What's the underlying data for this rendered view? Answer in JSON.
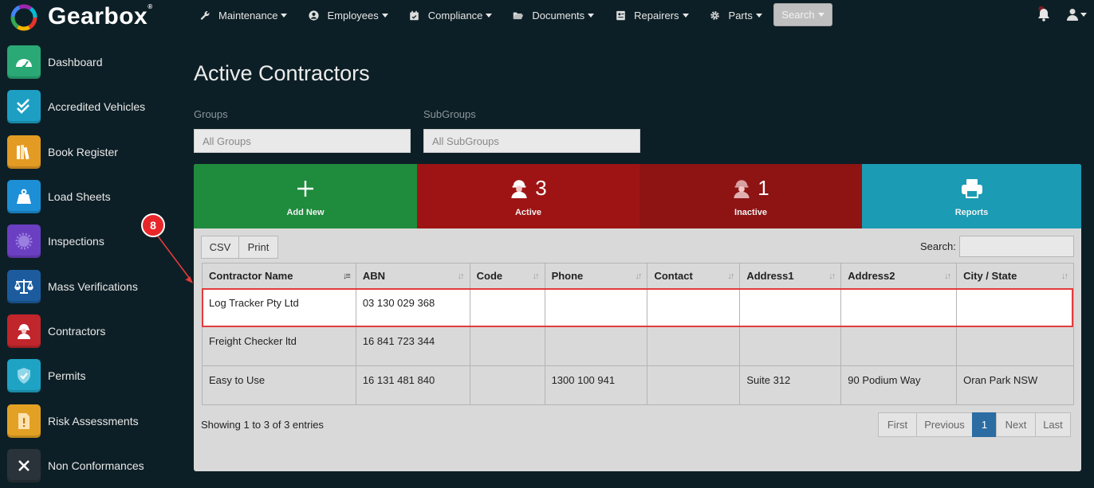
{
  "app": {
    "brand": "Gearbox"
  },
  "nav": {
    "items": [
      {
        "label": "Maintenance",
        "icon": "wrench-icon"
      },
      {
        "label": "Employees",
        "icon": "user-circle-icon"
      },
      {
        "label": "Compliance",
        "icon": "calendar-check-icon"
      },
      {
        "label": "Documents",
        "icon": "folder-open-icon"
      },
      {
        "label": "Repairers",
        "icon": "address-card-icon"
      },
      {
        "label": "Parts",
        "icon": "gear-icon"
      }
    ],
    "search_label": "Search"
  },
  "sidebar": {
    "items": [
      {
        "label": "Dashboard",
        "icon": "gauge-icon",
        "color": "#2aa876"
      },
      {
        "label": "Accredited Vehicles",
        "icon": "double-check-icon",
        "color": "#1d9fc4"
      },
      {
        "label": "Book Register",
        "icon": "books-icon",
        "color": "#e39b24"
      },
      {
        "label": "Load Sheets",
        "icon": "weight-icon",
        "color": "#1c8fd6"
      },
      {
        "label": "Inspections",
        "icon": "badge-icon",
        "color": "#6b3fc1"
      },
      {
        "label": "Mass Verifications",
        "icon": "scales-icon",
        "color": "#1c5c9e"
      },
      {
        "label": "Contractors",
        "icon": "worker-icon",
        "color": "#c0262c"
      },
      {
        "label": "Permits",
        "icon": "shield-check-icon",
        "color": "#1fa3c4"
      },
      {
        "label": "Risk Assessments",
        "icon": "risk-doc-icon",
        "color": "#e3a124"
      },
      {
        "label": "Non Conformances",
        "icon": "close-icon",
        "color": "#2a333a"
      }
    ]
  },
  "page": {
    "title": "Active Contractors",
    "groups_label": "Groups",
    "groups_value": "All Groups",
    "subgroups_label": "SubGroups",
    "subgroups_value": "All SubGroups"
  },
  "tiles": [
    {
      "label": "Add New",
      "count": "",
      "color": "#1f8b3d"
    },
    {
      "label": "Active",
      "count": "3",
      "color": "#9e1414"
    },
    {
      "label": "Inactive",
      "count": "1",
      "color": "#8e1414"
    },
    {
      "label": "Reports",
      "count": "",
      "color": "#1b9bb4"
    }
  ],
  "toolbar": {
    "csv": "CSV",
    "print": "Print",
    "search_label": "Search:"
  },
  "table": {
    "columns": [
      "Contractor Name",
      "ABN",
      "Code",
      "Phone",
      "Contact",
      "Address1",
      "Address2",
      "City / State"
    ],
    "rows": [
      [
        "Log Tracker Pty Ltd",
        "03 130 029 368",
        "",
        "",
        "",
        "",
        "",
        ""
      ],
      [
        "Freight Checker ltd",
        "16 841 723 344",
        "",
        "",
        "",
        "",
        "",
        ""
      ],
      [
        "Easy to Use",
        "16 131 481 840",
        "",
        "1300 100 941",
        "",
        "Suite 312",
        "90 Podium Way",
        "Oran Park NSW"
      ]
    ]
  },
  "footer": {
    "info": "Showing 1 to 3 of 3 entries",
    "pager": [
      "First",
      "Previous",
      "1",
      "Next",
      "Last"
    ]
  },
  "annotation": {
    "step": "8"
  }
}
